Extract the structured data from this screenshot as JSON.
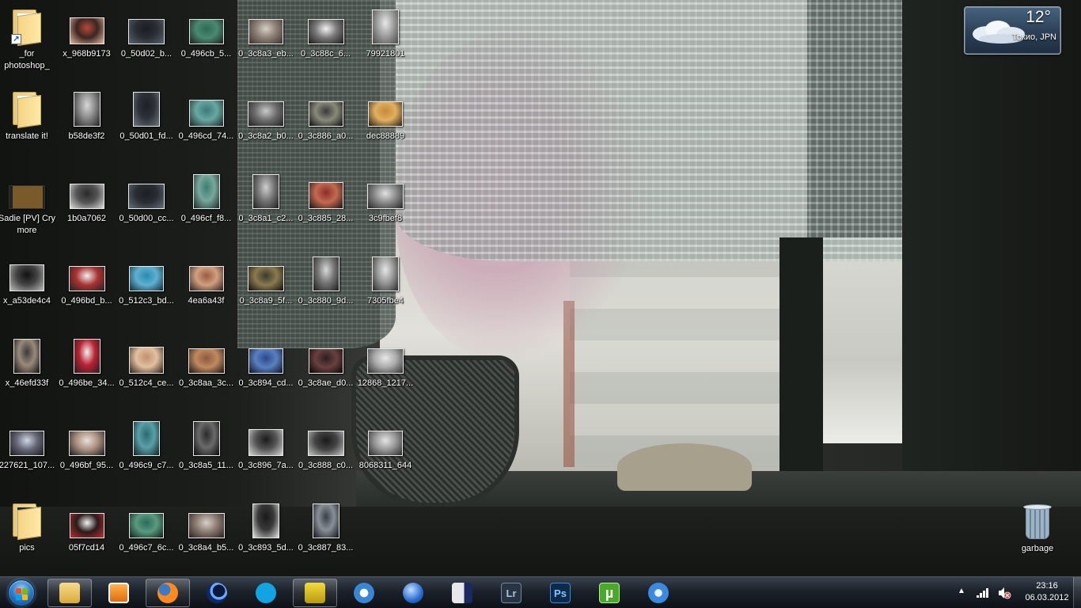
{
  "desktop": {
    "icons": [
      {
        "label": "_for photoshop_",
        "type": "folder-shortcut"
      },
      {
        "label": "x_968b9173",
        "type": "photo",
        "colors": [
          "#b94a3c",
          "#e6b8a0",
          "#3b2520"
        ]
      },
      {
        "label": "0_50d02_b...",
        "type": "photo",
        "colors": [
          "#1a1d22",
          "#5a6470",
          "#2b2f35"
        ]
      },
      {
        "label": "0_496cb_5...",
        "type": "photo",
        "colors": [
          "#2f6a55",
          "#1b1e1d",
          "#4a8a70"
        ]
      },
      {
        "label": "0_3c8a3_eb...",
        "type": "photo",
        "colors": [
          "#d7cfc4",
          "#3b3230",
          "#8c7f75"
        ]
      },
      {
        "label": "0_3c88c_6...",
        "type": "photo",
        "colors": [
          "#f2f2f2",
          "#1a1a1a",
          "#777"
        ]
      },
      {
        "label": "79921801",
        "type": "photo",
        "colors": [
          "#e8e8e8",
          "#4a4a4a",
          "#a0a0a0"
        ]
      },
      {
        "label": "translate it!",
        "type": "folder"
      },
      {
        "label": "b58de3f2",
        "type": "photo",
        "colors": [
          "#d8d8d8",
          "#202020",
          "#8a8a8a"
        ]
      },
      {
        "label": "0_50d01_fd...",
        "type": "photo",
        "colors": [
          "#1e2126",
          "#6a7580",
          "#2d3238"
        ]
      },
      {
        "label": "0_496cd_74...",
        "type": "photo",
        "colors": [
          "#3b7a78",
          "#162624",
          "#6aa7a3"
        ]
      },
      {
        "label": "0_3c8a2_b0...",
        "type": "photo",
        "colors": [
          "#c9c9c9",
          "#202020",
          "#6d6d6d"
        ]
      },
      {
        "label": "0_3c886_a0...",
        "type": "photo",
        "colors": [
          "#3a3a3a",
          "#0d0d0d",
          "#8a8a7a"
        ]
      },
      {
        "label": "dec88889",
        "type": "photo",
        "colors": [
          "#c58a3a",
          "#2a1d14",
          "#e0b060"
        ]
      },
      {
        "label": "Sadie [PV] Cry more",
        "type": "video"
      },
      {
        "label": "1b0a7062",
        "type": "photo",
        "colors": [
          "#2a2a2a",
          "#dcdcdc",
          "#555"
        ]
      },
      {
        "label": "0_50d00_cc...",
        "type": "photo",
        "colors": [
          "#1c1f24",
          "#646e78",
          "#2a2e34"
        ]
      },
      {
        "label": "0_496cf_f8...",
        "type": "photo",
        "colors": [
          "#3d7d70",
          "#1a2a26",
          "#78a89c"
        ]
      },
      {
        "label": "0_3c8a1_c2...",
        "type": "photo",
        "colors": [
          "#cfcfcf",
          "#1e1e1e",
          "#777"
        ]
      },
      {
        "label": "0_3c885_28...",
        "type": "photo",
        "colors": [
          "#8a2e2a",
          "#1a1212",
          "#c46a50"
        ]
      },
      {
        "label": "3c9fbef8",
        "type": "photo",
        "colors": [
          "#e2e2e2",
          "#262626",
          "#8a8a8a"
        ]
      },
      {
        "label": "x_a53de4c4",
        "type": "photo",
        "colors": [
          "#111111",
          "#bdbdbd",
          "#444"
        ]
      },
      {
        "label": "0_496bd_b...",
        "type": "photo",
        "colors": [
          "#f0f0f0",
          "#222",
          "#a33"
        ]
      },
      {
        "label": "0_512c3_bd...",
        "type": "photo",
        "colors": [
          "#2a8ab0",
          "#0d2a36",
          "#60b0d0"
        ]
      },
      {
        "label": "4ea6a43f",
        "type": "photo",
        "colors": [
          "#9a5a40",
          "#2a1c18",
          "#d0a080"
        ]
      },
      {
        "label": "0_3c8a9_5f...",
        "type": "photo",
        "colors": [
          "#3a3a2a",
          "#0f0f0a",
          "#8a7a50"
        ]
      },
      {
        "label": "0_3c880_9d...",
        "type": "photo",
        "colors": [
          "#d8d8d8",
          "#1c1c1c",
          "#777"
        ]
      },
      {
        "label": "7305fbe4",
        "type": "photo",
        "colors": [
          "#e6e6e6",
          "#2a2a2a",
          "#999"
        ]
      },
      {
        "label": "x_46efd33f",
        "type": "photo",
        "colors": [
          "#3a3a3a",
          "#0e0e0e",
          "#9a8a7a"
        ]
      },
      {
        "label": "0_496be_34...",
        "type": "photo",
        "colors": [
          "#f0f0f0",
          "#1f1f1f",
          "#b23"
        ]
      },
      {
        "label": "0_512c4_ce...",
        "type": "photo",
        "colors": [
          "#c09070",
          "#2a1e18",
          "#e2c0a0"
        ]
      },
      {
        "label": "0_3c8aa_3c...",
        "type": "photo",
        "colors": [
          "#8a5a40",
          "#1a1210",
          "#c08a60"
        ]
      },
      {
        "label": "0_3c894_cd...",
        "type": "photo",
        "colors": [
          "#2a4a8a",
          "#0a1226",
          "#5a80c0"
        ]
      },
      {
        "label": "0_3c8ae_d0...",
        "type": "photo",
        "colors": [
          "#2a2020",
          "#080606",
          "#6a4040"
        ]
      },
      {
        "label": "12868_1217...",
        "type": "photo",
        "colors": [
          "#e8e8e8",
          "#303030",
          "#aaa"
        ]
      },
      {
        "label": "227621_107...",
        "type": "photo",
        "colors": [
          "#d0d8e0",
          "#1a1a1a",
          "#667"
        ]
      },
      {
        "label": "0_496bf_95...",
        "type": "photo",
        "colors": [
          "#e8e0d8",
          "#1a1a1a",
          "#aa9080"
        ]
      },
      {
        "label": "0_496c9_c7...",
        "type": "photo",
        "colors": [
          "#2a6a70",
          "#0e2022",
          "#5aa0a8"
        ]
      },
      {
        "label": "0_3c8a5_11...",
        "type": "photo",
        "colors": [
          "#2a2a2a",
          "#0a0a0a",
          "#6a6a6a"
        ]
      },
      {
        "label": "0_3c896_7a...",
        "type": "photo",
        "colors": [
          "#1a1a1a",
          "#d8d8d8",
          "#555"
        ]
      },
      {
        "label": "0_3c888_c0...",
        "type": "photo",
        "colors": [
          "#1a1a1a",
          "#c8c8c8",
          "#444"
        ]
      },
      {
        "label": "8068311_644",
        "type": "photo",
        "colors": [
          "#e4e4e4",
          "#2a2a2a",
          "#999"
        ]
      },
      {
        "label": "pics",
        "type": "folder-dark"
      },
      {
        "label": "05f7cd14",
        "type": "photo",
        "colors": [
          "#f2f2f2",
          "#c03030",
          "#2a1a1a"
        ]
      },
      {
        "label": "0_496c7_6c...",
        "type": "photo",
        "colors": [
          "#2a6a5a",
          "#0e1e1a",
          "#5a9a80"
        ]
      },
      {
        "label": "0_3c8a4_b5...",
        "type": "photo",
        "colors": [
          "#d8d0c8",
          "#2a2020",
          "#8a7a70"
        ]
      },
      {
        "label": "0_3c893_5d...",
        "type": "photo",
        "colors": [
          "#1a1a1a",
          "#e0e0e0",
          "#3a3a3a"
        ]
      },
      {
        "label": "0_3c887_83...",
        "type": "photo",
        "colors": [
          "#3a4048",
          "#101418",
          "#8a9098"
        ]
      }
    ],
    "recycle_bin": {
      "label": "garbage"
    }
  },
  "weather": {
    "temperature": "12°",
    "city": "Токио, JPN"
  },
  "taskbar": {
    "start_icon": "windows-start-orb",
    "apps": [
      {
        "name": "windows-explorer-icon",
        "open": true
      },
      {
        "name": "media-center-icon",
        "open": false
      },
      {
        "name": "firefox-icon",
        "open": true
      },
      {
        "name": "moon-app-icon",
        "open": false
      },
      {
        "name": "skype-icon",
        "open": false
      },
      {
        "name": "yellow-tool-icon",
        "open": true
      },
      {
        "name": "media-player-icon",
        "open": false
      },
      {
        "name": "globe-app-icon",
        "open": false
      },
      {
        "name": "video-file-icon",
        "open": false
      },
      {
        "name": "lightroom-icon",
        "open": false,
        "text": "Lr"
      },
      {
        "name": "photoshop-icon",
        "open": false,
        "text": "Ps"
      },
      {
        "name": "utorrent-icon",
        "open": false,
        "text": "µ"
      },
      {
        "name": "itunes-icon",
        "open": false
      }
    ],
    "tray": {
      "expand_glyph": "▲",
      "time": "23:16",
      "date": "06.03.2012"
    }
  }
}
